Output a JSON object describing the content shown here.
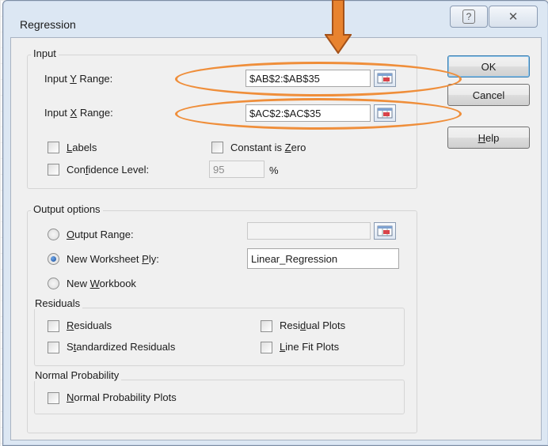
{
  "window": {
    "title": "Regression",
    "help_glyph": "?",
    "close_glyph": "✕"
  },
  "input": {
    "group_label": "Input",
    "y_range": {
      "label_pre": "Input ",
      "label_mnemonic": "Y",
      "label_post": " Range:",
      "value": "$AB$2:$AB$35"
    },
    "x_range": {
      "label_pre": "Input ",
      "label_mnemonic": "X",
      "label_post": " Range:",
      "value": "$AC$2:$AC$35"
    },
    "labels": {
      "mnemonic": "L",
      "rest": "abels",
      "checked": false
    },
    "constant_zero": {
      "pre": "Constant is ",
      "mnemonic": "Z",
      "rest": "ero",
      "checked": false
    },
    "confidence": {
      "pre": "Con",
      "mnemonic": "f",
      "rest": "idence Level:",
      "checked": false,
      "value": "95",
      "unit": "%"
    }
  },
  "output": {
    "group_label": "Output options",
    "output_range": {
      "mnemonic": "O",
      "rest": "utput Range:",
      "selected": false,
      "value": ""
    },
    "new_worksheet": {
      "pre": "New Worksheet ",
      "mnemonic": "P",
      "rest": "ly:",
      "selected": true,
      "value": "Linear_Regression"
    },
    "new_workbook": {
      "pre": "New ",
      "mnemonic": "W",
      "rest": "orkbook",
      "selected": false
    }
  },
  "residuals": {
    "group_label": "Residuals",
    "residuals": {
      "mnemonic": "R",
      "rest": "esiduals",
      "checked": false
    },
    "standardized": {
      "pre": "S",
      "mnemonic": "t",
      "rest": "andardized Residuals",
      "checked": false
    },
    "residual_plots": {
      "pre": "Resi",
      "mnemonic": "d",
      "rest": "ual Plots",
      "checked": false
    },
    "line_fit_plots": {
      "mnemonic": "L",
      "rest": "ine Fit Plots",
      "checked": false
    }
  },
  "normal_probability": {
    "group_label": "Normal Probability",
    "plots": {
      "mnemonic": "N",
      "rest": "ormal Probability Plots",
      "checked": false
    }
  },
  "buttons": {
    "ok": "OK",
    "cancel": "Cancel",
    "help_mnemonic": "H",
    "help_rest": "elp"
  },
  "colors": {
    "annotation_orange": "#ef8e3a",
    "arrow_fill": "#e8832f",
    "arrow_stroke": "#a4521a"
  }
}
